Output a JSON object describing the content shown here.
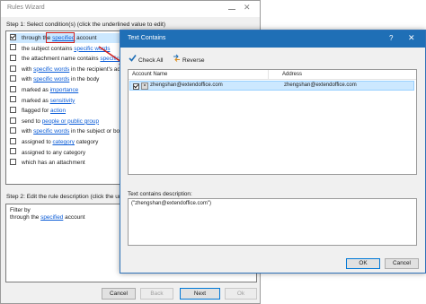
{
  "rules_wizard": {
    "title": "Rules Wizard",
    "step1": "Step 1: Select condition(s) (click the underlined value to edit)",
    "conditions": [
      {
        "checked": true,
        "pre": "through the ",
        "link": "specified",
        "post": " account"
      },
      {
        "checked": false,
        "pre": "the subject contains ",
        "link": "specific words",
        "post": ""
      },
      {
        "checked": false,
        "pre": "the attachment name contains ",
        "link": "specific words",
        "post": ""
      },
      {
        "checked": false,
        "pre": "with ",
        "link": "specific words",
        "post": " in the recipient's addre"
      },
      {
        "checked": false,
        "pre": "with ",
        "link": "specific words",
        "post": " in the body"
      },
      {
        "checked": false,
        "pre": "marked as ",
        "link": "importance",
        "post": ""
      },
      {
        "checked": false,
        "pre": "marked as ",
        "link": "sensitivity",
        "post": ""
      },
      {
        "checked": false,
        "pre": "flagged for ",
        "link": "action",
        "post": ""
      },
      {
        "checked": false,
        "pre": "send to ",
        "link": "people or public group",
        "post": ""
      },
      {
        "checked": false,
        "pre": "with ",
        "link": "specific words",
        "post": " in the subject or body"
      },
      {
        "checked": false,
        "pre": "assigned to ",
        "link": "category",
        "post": " category"
      },
      {
        "checked": false,
        "pre": "assigned to any category",
        "link": "",
        "post": ""
      },
      {
        "checked": false,
        "pre": "which has an attachment",
        "link": "",
        "post": ""
      }
    ],
    "step2": "Step 2: Edit the rule description (click the underlined value)",
    "description": {
      "line1": "Filter by",
      "line2_pre": "through the ",
      "line2_link": "specified",
      "line2_post": " account"
    },
    "buttons": {
      "cancel": "Cancel",
      "back": "Back",
      "next": "Next",
      "ok": "Ok"
    }
  },
  "text_contains": {
    "title": "Text Contains",
    "help_glyph": "?",
    "close_glyph": "✕",
    "toolbar": {
      "check_all": "Check All",
      "reverse": "Reverse"
    },
    "columns": {
      "account": "Account Name",
      "address": "Address"
    },
    "rows": [
      {
        "checked": true,
        "account": "zhengshan@extendoffice.com",
        "address": "zhengshan@extendoffice.com"
      }
    ],
    "desc_label": "Text contains description:",
    "desc_value": "(\"zhengshan@extendoffice.com\")",
    "buttons": {
      "ok": "OK",
      "cancel": "Cancel"
    }
  },
  "colors": {
    "accent": "#1f6fb6",
    "link": "#0b5cd7",
    "highlight": "#d0201d",
    "selection": "#cce8ff"
  },
  "icons": {
    "check_all": "checkmark-icon",
    "reverse": "reverse-arrows-icon",
    "account": "contact-card-icon"
  }
}
